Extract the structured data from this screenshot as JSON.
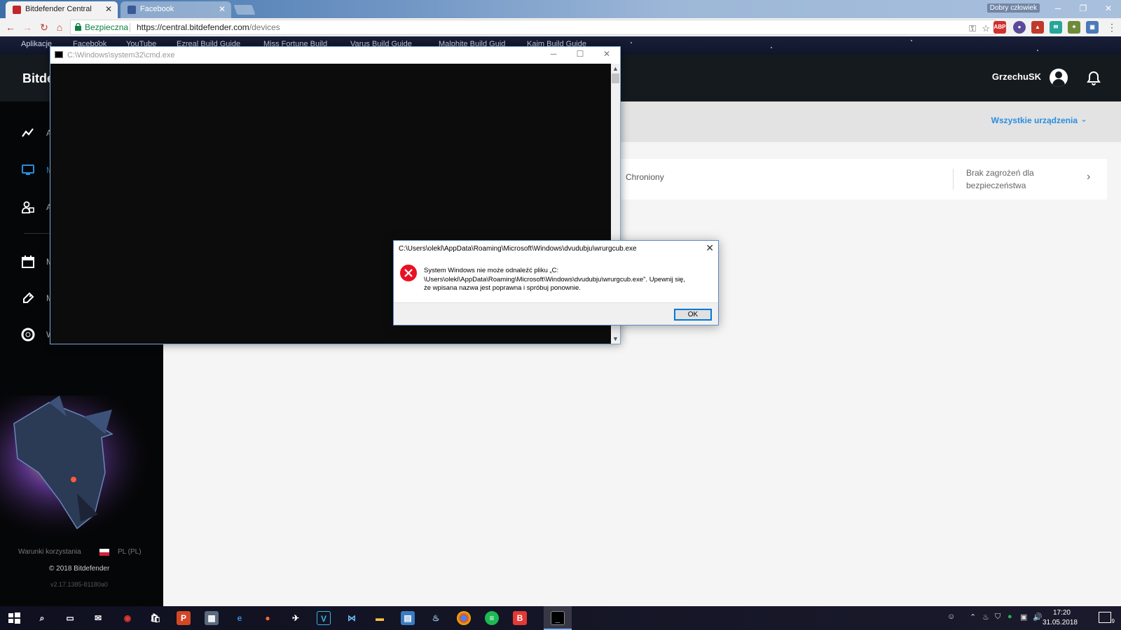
{
  "browser": {
    "tabs": [
      {
        "label": "Bitdefender Central",
        "active": true
      },
      {
        "label": "Facebook",
        "active": false
      }
    ],
    "profile_name": "Dobry człowiek",
    "security_label": "Bezpieczna",
    "url_host": "https://central.bitdefender.com",
    "url_path": "/devices",
    "bookmarks": [
      "Aplikacje",
      "Facebook",
      "YouTube",
      "Ezreal Build Guide",
      "Miss Fortune Build",
      "Varus Build Guide",
      "Malphite Build Guid",
      "Kaim Build Guide"
    ]
  },
  "bitdefender": {
    "logo": "Bitde",
    "username": "GrzechuSK",
    "sidebar_partial_labels": [
      "A",
      "M",
      "A",
      "M",
      "M",
      "W"
    ],
    "footer": {
      "terms": "Warunki korzystania",
      "language": "PL (PL)",
      "copyright": "© 2018 Bitdefender",
      "version": "v2.17.1385-81180a0"
    },
    "filter_label": "Wszystkie urządzenia",
    "device": {
      "status": "Chroniony",
      "threat_status": "Brak zagrożeń dla bezpieczeństwa"
    }
  },
  "cmd": {
    "title": "C:\\Windows\\system32\\cmd.exe"
  },
  "dialog": {
    "title": "C:\\Users\\olekl\\AppData\\Roaming\\Microsoft\\Windows\\dvudubju\\wrurgcub.exe",
    "message_line1": "System Windows nie może odnaleźć pliku „C:",
    "message_line2": "\\Users\\olekl\\AppData\\Roaming\\Microsoft\\Windows\\dvudubju\\wrurgcub.exe\". Upewnij się,",
    "message_line3": "że wpisana nazwa jest poprawna i spróbuj ponownie.",
    "ok_label": "OK"
  },
  "taskbar": {
    "time": "17:20",
    "date": "31.05.2018",
    "notification_count": "9"
  },
  "colors": {
    "accent_blue": "#2a8de0",
    "secure_green": "#0b8043",
    "error_red": "#e81123",
    "dialog_border": "#5e8ac7"
  }
}
